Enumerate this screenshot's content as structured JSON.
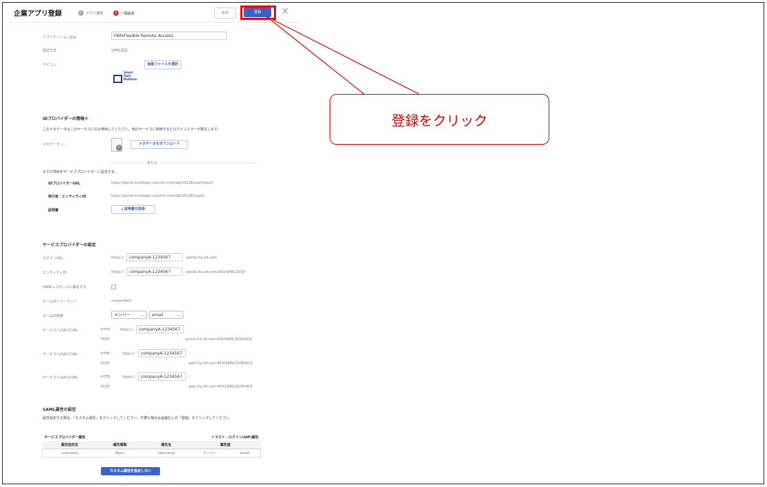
{
  "header": {
    "title": "企業アプリ登録",
    "step1": "アプリ選択",
    "step2_num": "2",
    "step2": "一般設定",
    "back_label": "戻る",
    "register_label": "登録",
    "close_glyph": "×"
  },
  "app_fields": {
    "name_label": "アプリケーション名",
    "name_value": "FRA(Flexible Remote Access)",
    "auth_label": "認証方法",
    "auth_value": "SAML認証",
    "icon_label": "アイコン",
    "icon_button": "画像ファイルを選択",
    "logo_lines": [
      "Smart",
      "Data",
      "Platform"
    ]
  },
  "idp": {
    "heading": "IDプロバイダーの情報",
    "note": "このメタデータはこのサービスにのみ使用してください。他のサービスに使用するとログインエラーが発生します。",
    "metadata_label": "メタデータ",
    "download_button": "メタデータをダウンロード",
    "or": "または",
    "configure_note": "以下の項目をサービスプロバイダーに設定する。",
    "idp_url_label": "IDプロバイダーURL",
    "idp_url_value": "https://portal.trustlogin.com/ntt-com/idp/152382/saml/auth",
    "issuer_label": "発行者・エンティティID",
    "issuer_value": "https://portal.trustlogin.com/ntt-com/idp/152382/saml",
    "cert_label": "証明書",
    "cert_button": "証明書を取得"
  },
  "sp": {
    "heading": "サービスプロバイダーの設定",
    "login_url_label": "ログインURL",
    "entity_label": "エンティティID",
    "https": "https://",
    "company": "companyA-1234567",
    "login_suffix": "-portal.fra.ntt.com",
    "entity_suffix": "-portal.fra.ntt.com:443/SAML20/SP",
    "sign_label": "SAMLレスポンスに署名する",
    "nameid_format_label": "ネームIDフォーマット",
    "nameid_format_value": "unspecified",
    "nameid_attr_label": "ネームID用値",
    "nameid_select1": "メンバー",
    "nameid_select2": "email",
    "acs_label": "サービスへのACS URL",
    "http": "HTTP-",
    "post": "POST",
    "dash": "-",
    "acs_suffixes": [
      "portal.fra.ntt.com:443/SAML20/SP/ACS",
      "gw0.fra.ntt.com:443/SAML20/SP/ACS",
      "gw1.fra.ntt.com:443/SAML20/SP/ACS"
    ]
  },
  "saml_attr": {
    "heading": "SAML属性の設定",
    "note": "属性指定する場合、「カスタム属性」をクリックしてください。不要な場合は画面右上の「登録」をクリックしてください。",
    "table": {
      "group1": "サービスプロバイダー属性",
      "group2": "トラスト・ログイン(IdP)属性",
      "headers": [
        "属性指定名",
        "属性種類",
        "属性名",
        "属性値"
      ],
      "row": [
        "username",
        "Basic",
        "username",
        "メンバー",
        "email"
      ]
    },
    "button": "カスタム属性を指定しない"
  },
  "callout": {
    "text": "登録をクリック",
    "color": "#dd0000"
  },
  "colors": {
    "accent": "#3a62c9",
    "highlight": "#ee0000"
  }
}
